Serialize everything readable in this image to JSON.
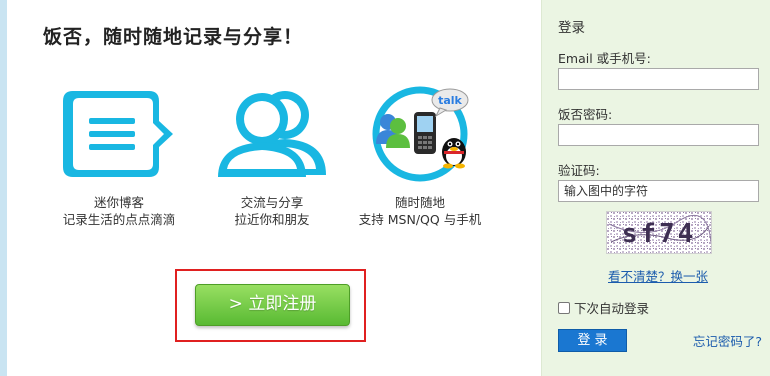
{
  "main": {
    "headline": "饭否，随时随地记录与分享！",
    "features": [
      {
        "icon": "speech-bubble-list-icon",
        "line1": "迷你博客",
        "line2": "记录生活的点点滴滴"
      },
      {
        "icon": "people-icon",
        "line1": "交流与分享",
        "line2": "拉近你和朋友"
      },
      {
        "icon": "devices-im-icon",
        "line1": "随时随地",
        "line2": "支持 MSN/QQ 与手机",
        "badge": "talk"
      }
    ],
    "register_button": "> 立即注册"
  },
  "login": {
    "title": "登录",
    "email_label": "Email 或手机号:",
    "email_value": "",
    "password_label": "饭否密码:",
    "password_value": "",
    "captcha_label": "验证码:",
    "captcha_placeholder": "输入图中的字符",
    "captcha_text": "sf74",
    "refresh_link": "看不清楚？换一张",
    "remember_label": "下次自动登录",
    "login_button": "登 录",
    "forgot_link": "忘记密码了?"
  },
  "colors": {
    "icon_cyan": "#19b7e2",
    "register_green": "#6cc83b",
    "login_blue": "#1a77d1",
    "sidebar_bg": "#ebf5e3",
    "frame_red": "#e02020"
  }
}
